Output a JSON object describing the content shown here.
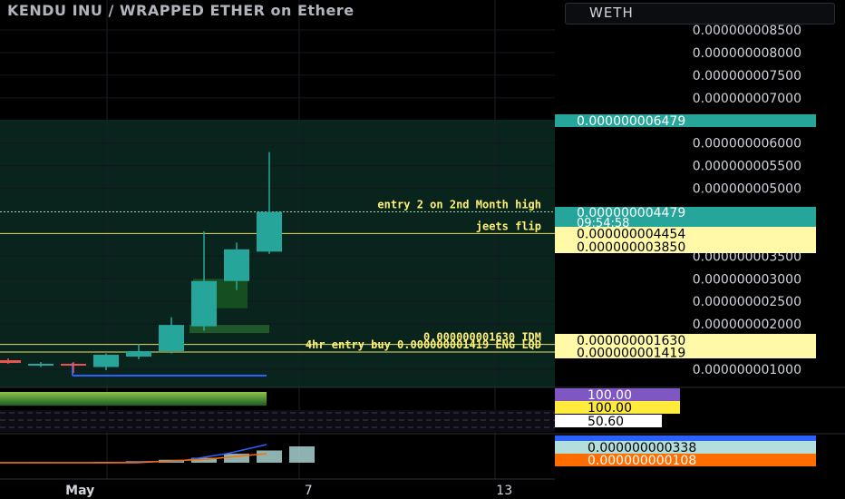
{
  "title": "KENDU INU / WRAPPED ETHER on Ethere",
  "symbol": "WETH",
  "chart_data": {
    "type": "candlestick",
    "price_axis": {
      "ticks": [
        "0.000000008500",
        "0.000000008000",
        "0.000000007500",
        "0.000000007000",
        "0.000000006000",
        "0.000000005500",
        "0.000000005000",
        "0.000000003500",
        "0.000000003000",
        "0.000000002500",
        "0.000000002000",
        "0.000000001000"
      ],
      "tick_values": [
        8.5e-09,
        8e-09,
        7.5e-09,
        7e-09,
        6e-09,
        5.5e-09,
        5e-09,
        3.5e-09,
        3e-09,
        2.5e-09,
        2e-09,
        1e-09
      ]
    },
    "time_axis": {
      "labels": [
        {
          "label": "May",
          "bar": 1.2
        },
        {
          "label": "7",
          "bar": 8.2
        },
        {
          "label": "13",
          "bar": 14.2
        }
      ]
    },
    "candles": [
      {
        "bar": -1,
        "open": 1.2e-09,
        "high": 1.24e-09,
        "low": 1.12e-09,
        "close": 1.14e-09
      },
      {
        "bar": 0,
        "open": 1.12e-09,
        "high": 1.16e-09,
        "low": 1.05e-09,
        "close": 1.12e-09
      },
      {
        "bar": 1,
        "open": 1.12e-09,
        "high": 1.16e-09,
        "low": 9.2e-10,
        "close": 1.1e-09
      },
      {
        "bar": 2,
        "open": 1.05e-09,
        "high": 1.35e-09,
        "low": 9.8e-10,
        "close": 1.32e-09
      },
      {
        "bar": 3,
        "open": 1.28e-09,
        "high": 1.55e-09,
        "low": 1.22e-09,
        "close": 1.4e-09
      },
      {
        "bar": 4,
        "open": 1.4e-09,
        "high": 2.15e-09,
        "low": 1.35e-09,
        "close": 1.98e-09
      },
      {
        "bar": 5,
        "open": 1.95e-09,
        "high": 4.05e-09,
        "low": 1.85e-09,
        "close": 2.95e-09
      },
      {
        "bar": 6,
        "open": 2.95e-09,
        "high": 3.8e-09,
        "low": 2.75e-09,
        "close": 3.65e-09
      },
      {
        "bar": 7,
        "open": 3.6e-09,
        "high": 5.8e-09,
        "low": 3.55e-09,
        "close": 4.479e-09
      }
    ],
    "levels": [
      {
        "price": 4.479e-09,
        "label": "entry 2 on 2nd Month high",
        "style": "dotted"
      },
      {
        "price": 4e-09,
        "label": "jeets flip",
        "style": "solid"
      },
      {
        "price": 1.55e-09,
        "label": "0.000000001630 IDM",
        "style": "solid"
      },
      {
        "price": 1.38e-09,
        "label": "4hr entry buy 0.000000001419 ENG LQD",
        "style": "solid"
      }
    ],
    "price_tags": [
      {
        "text": "0.000000006479",
        "price": 6.479e-09,
        "color": "#26a69a",
        "text_color": "#ffffff"
      },
      {
        "text": "0.000000004479",
        "sub": "09:54:58",
        "price": 4.479e-09,
        "color": "#26a69a",
        "text_color": "#ffffff"
      },
      {
        "text": "0.000000004454",
        "price": 4.29e-09,
        "color": "#fff9a8",
        "text_color": "#000000"
      },
      {
        "text": "0.000000003850",
        "price": 4.05e-09,
        "color": "#fff9a8",
        "text_color": "#000000"
      },
      {
        "text": "0.000000001630",
        "price": 1.63e-09,
        "color": "#fff9a8",
        "text_color": "#000000"
      },
      {
        "text": "0.000000001419",
        "price": 1.419e-09,
        "color": "#fff9a8",
        "text_color": "#000000"
      }
    ],
    "indicator_tags": [
      {
        "text": "100.00",
        "color": "#7e57c2",
        "text_color": "#ffffff"
      },
      {
        "text": "100.00",
        "color": "#ffeb3b",
        "text_color": "#000000"
      },
      {
        "text": "50.60",
        "color": "#ffffff",
        "text_color": "#000000"
      },
      {
        "text": "0.000000000338",
        "color": "#b2dfdb",
        "text_color": "#000000"
      },
      {
        "text": "0.000000000108",
        "color": "#ff6d00",
        "text_color": "#ffffff"
      }
    ],
    "volume": [
      0.03,
      0.02,
      0.05,
      0.1,
      0.18,
      0.3,
      0.55,
      0.75,
      1.0
    ],
    "grid": true
  }
}
